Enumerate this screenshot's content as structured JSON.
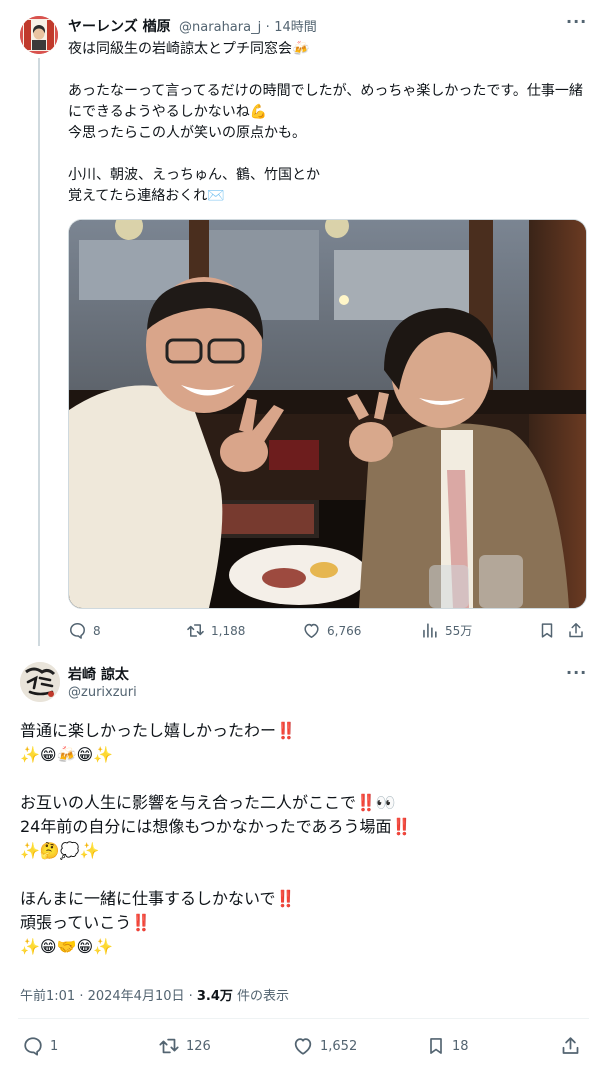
{
  "tweet": {
    "author_name": "ヤーレンズ 楢原",
    "handle": "@narahara_j",
    "separator": "·",
    "time": "14時間",
    "text": "夜は同級生の岩崎諒太とプチ同窓会🍻\n\nあったなーって言ってるだけの時間でしたが、めっちゃ楽しかったです。仕事一緒にできるようやるしかないね💪\n今思ったらこの人が笑いの原点かも。\n\n小川、朝波、えっちゅん、鶴、竹国とか\n覚えてたら連絡おくれ✉️",
    "replies": "8",
    "retweets": "1,188",
    "likes": "6,766",
    "views": "55万"
  },
  "reply": {
    "author_name": "岩崎 諒太",
    "handle": "@zurixzuri",
    "avatar_text": "岩崎",
    "text": "普通に楽しかったし嬉しかったわー‼️\n✨😁🍻😁✨\n\nお互いの人生に影響を与え合った二人がここで‼️👀\n24年前の自分には想像もつかなかったであろう場面‼️\n✨🤔💭✨\n\nほんまに一緒に仕事するしかないで‼️\n頑張っていこう‼️\n✨😁🤝😁✨",
    "timestamp": "午前1:01 · 2024年4月10日 · ",
    "view_count": "3.4万",
    "view_suffix": " 件の表示",
    "replies": "1",
    "retweets": "126",
    "likes": "1,652",
    "bookmarks": "18"
  },
  "icons": {
    "reply": "reply-icon",
    "retweet": "retweet-icon",
    "like": "heart-icon",
    "views": "views-icon",
    "bookmark": "bookmark-icon",
    "share": "share-icon",
    "more": "more-icon"
  }
}
